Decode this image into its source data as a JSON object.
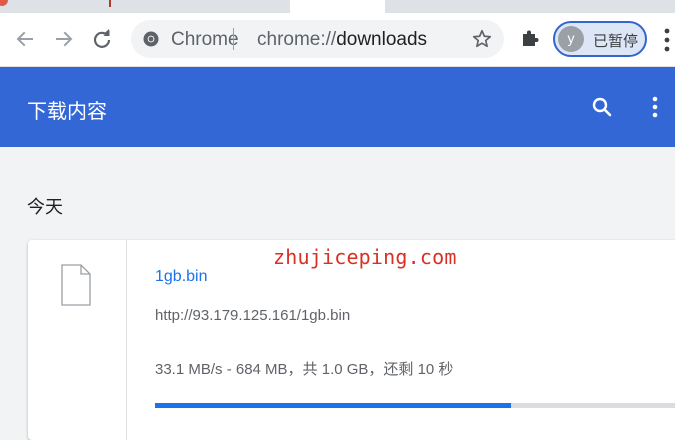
{
  "browser": {
    "omnibox": {
      "site_label": "Chrome",
      "url_scheme": "chrome://",
      "url_host": "downloads"
    },
    "profile": {
      "avatar_initial": "y",
      "status_label": "已暂停"
    },
    "icons": [
      "back-arrow-icon",
      "forward-arrow-icon",
      "reload-icon",
      "chrome-logo-icon",
      "star-icon",
      "extensions-puzzle-icon",
      "menu-dots-icon"
    ]
  },
  "page": {
    "title": "下载内容",
    "section_date": "今天"
  },
  "downloads": [
    {
      "file_name": "1gb.bin",
      "url": "http://93.179.125.161/1gb.bin",
      "status": "33.1 MB/s - 684 MB，共 1.0 GB，还剩 10 秒",
      "progress_fraction": 0.668
    }
  ],
  "watermark": "zhujiceping.com",
  "colors": {
    "header_blue": "#3367d6",
    "link_blue": "#1a73e8",
    "watermark_red": "#d93025"
  }
}
